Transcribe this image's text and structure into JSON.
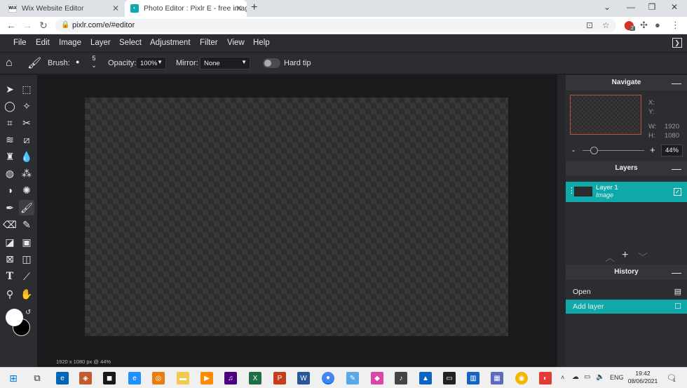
{
  "browser": {
    "tabs": [
      {
        "title": "Wix Website Editor",
        "icon": "wix-icon"
      },
      {
        "title": "Photo Editor : Pixlr E - free image",
        "icon": "pixlr-icon"
      }
    ],
    "url": "pixlr.com/e/#editor",
    "profile_badge": "2"
  },
  "app": {
    "menu": [
      "File",
      "Edit",
      "Image",
      "Layer",
      "Select",
      "Adjustment",
      "Filter",
      "View",
      "Help"
    ],
    "options": {
      "brush_label": "Brush:",
      "brush_size": "5",
      "opacity_label": "Opacity:",
      "opacity_value": "100%",
      "mirror_label": "Mirror:",
      "mirror_value": "None",
      "hardtip_label": "Hard tip"
    },
    "status": "1920 x 1080 px @ 44%"
  },
  "panels": {
    "navigate": {
      "title": "Navigate",
      "x_label": "X:",
      "y_label": "Y:",
      "w_label": "W:",
      "w_value": "1920",
      "h_label": "H:",
      "h_value": "1080",
      "zoom_value": "44%",
      "minus": "-",
      "plus": "+",
      "zoom_level": 0.44
    },
    "layers": {
      "title": "Layers",
      "items": [
        {
          "name": "Layer 1",
          "type": "Image"
        }
      ]
    },
    "history": {
      "title": "History",
      "items": [
        "Open",
        "Add layer"
      ]
    }
  },
  "taskbar": {
    "time": "19:42",
    "date": "08/06/2021",
    "lang": "ENG",
    "notif_count": "1"
  },
  "colors": {
    "accent": "#0fa9a9",
    "ui_dark": "#2b2d31",
    "workspace": "#1a1a1c"
  }
}
